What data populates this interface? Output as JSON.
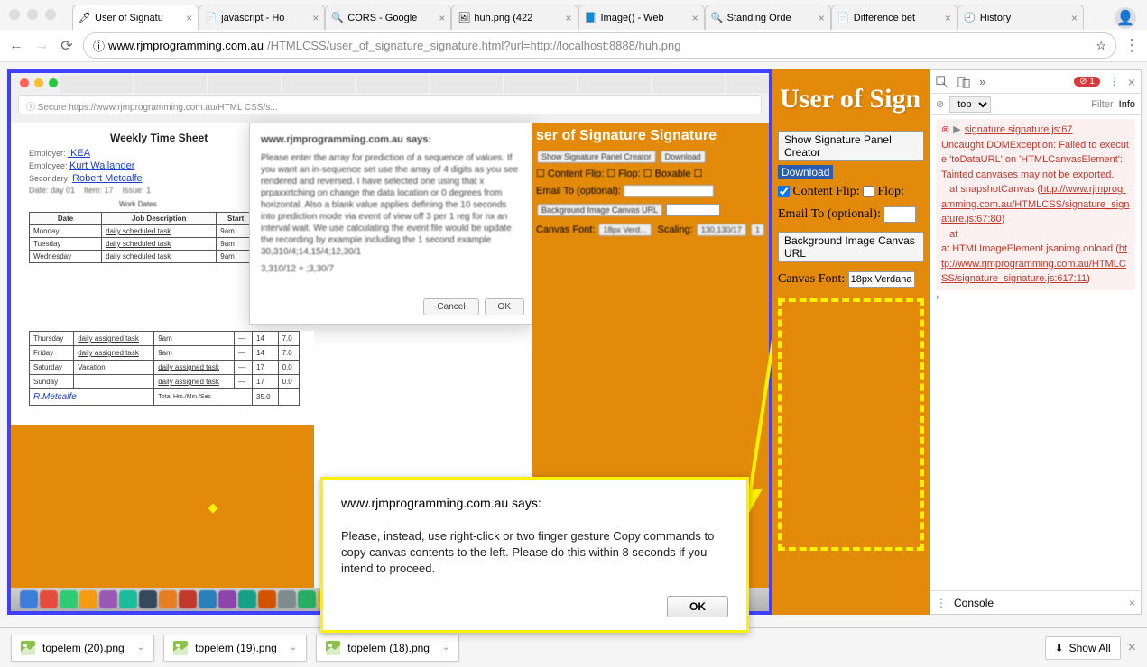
{
  "tabs": [
    {
      "label": "User of Signatu",
      "active": true
    },
    {
      "label": "javascript - Ho"
    },
    {
      "label": "CORS - Google"
    },
    {
      "label": "huh.png (422"
    },
    {
      "label": "Image() - Web"
    },
    {
      "label": "Standing Orde"
    },
    {
      "label": "Difference bet"
    },
    {
      "label": "History"
    }
  ],
  "url": {
    "info": "ⓘ",
    "host": "www.rjmprogramming.com.au",
    "path": "/HTMLCSS/user_of_signature_signature.html?url=http://localhost:8888/huh.png",
    "star": "☆"
  },
  "inner": {
    "timesheet_title": "Weekly Time Sheet",
    "employer": "IKEA",
    "employee1": "Kurt Wallander",
    "employee2": "Robert Metcalfe",
    "inner_alert_title": "www.rjmprogramming.com.au says:",
    "inner_alert_btn1": "Cancel",
    "inner_alert_btn2": "OK",
    "orange_title": "ser of Signature Signature"
  },
  "alert": {
    "title": "www.rjmprogramming.com.au says:",
    "msg": "Please, instead, use right-click or two finger gesture Copy commands to copy canvas contents to the left.  Please do this within 8 seconds if you intend to proceed.",
    "ok": "OK"
  },
  "right": {
    "title": "User of Sign",
    "btn_show": "Show Signature Panel Creator",
    "link_dl": "Download",
    "label_flip": "Content Flip:",
    "label_flop": "Flop:",
    "label_email": "Email To (optional):",
    "btn_bgurl": "Background Image Canvas URL",
    "label_font": "Canvas Font:",
    "font_value": "18px Verdana"
  },
  "devtools": {
    "err_count": "1",
    "top": "top",
    "filter": "Filter",
    "info": "Info",
    "err_source": "signature signature.js:67",
    "err_msg1": "Uncaught DOMException: Failed to execute 'toDataURL' on 'HTMLCanvasElement': Tainted canvases may not be exported.",
    "err_at1": "at snapshotCanvas (",
    "err_link1": "http://www.rjmprogramming.com.au/HTMLCSS/signature_signature.js:67:80",
    "err_close1": ")",
    "err_at2": "at HTMLImageElement.jsanimg.onload (",
    "err_link2": "http://www.rjmprogramming.com.au/HTMLCSS/signature_signature.js:617:11",
    "err_close2": ")",
    "console": "Console"
  },
  "downloads": {
    "items": [
      "topelem (20).png",
      "topelem (19).png",
      "topelem (18).png"
    ],
    "showall": "Show All"
  }
}
